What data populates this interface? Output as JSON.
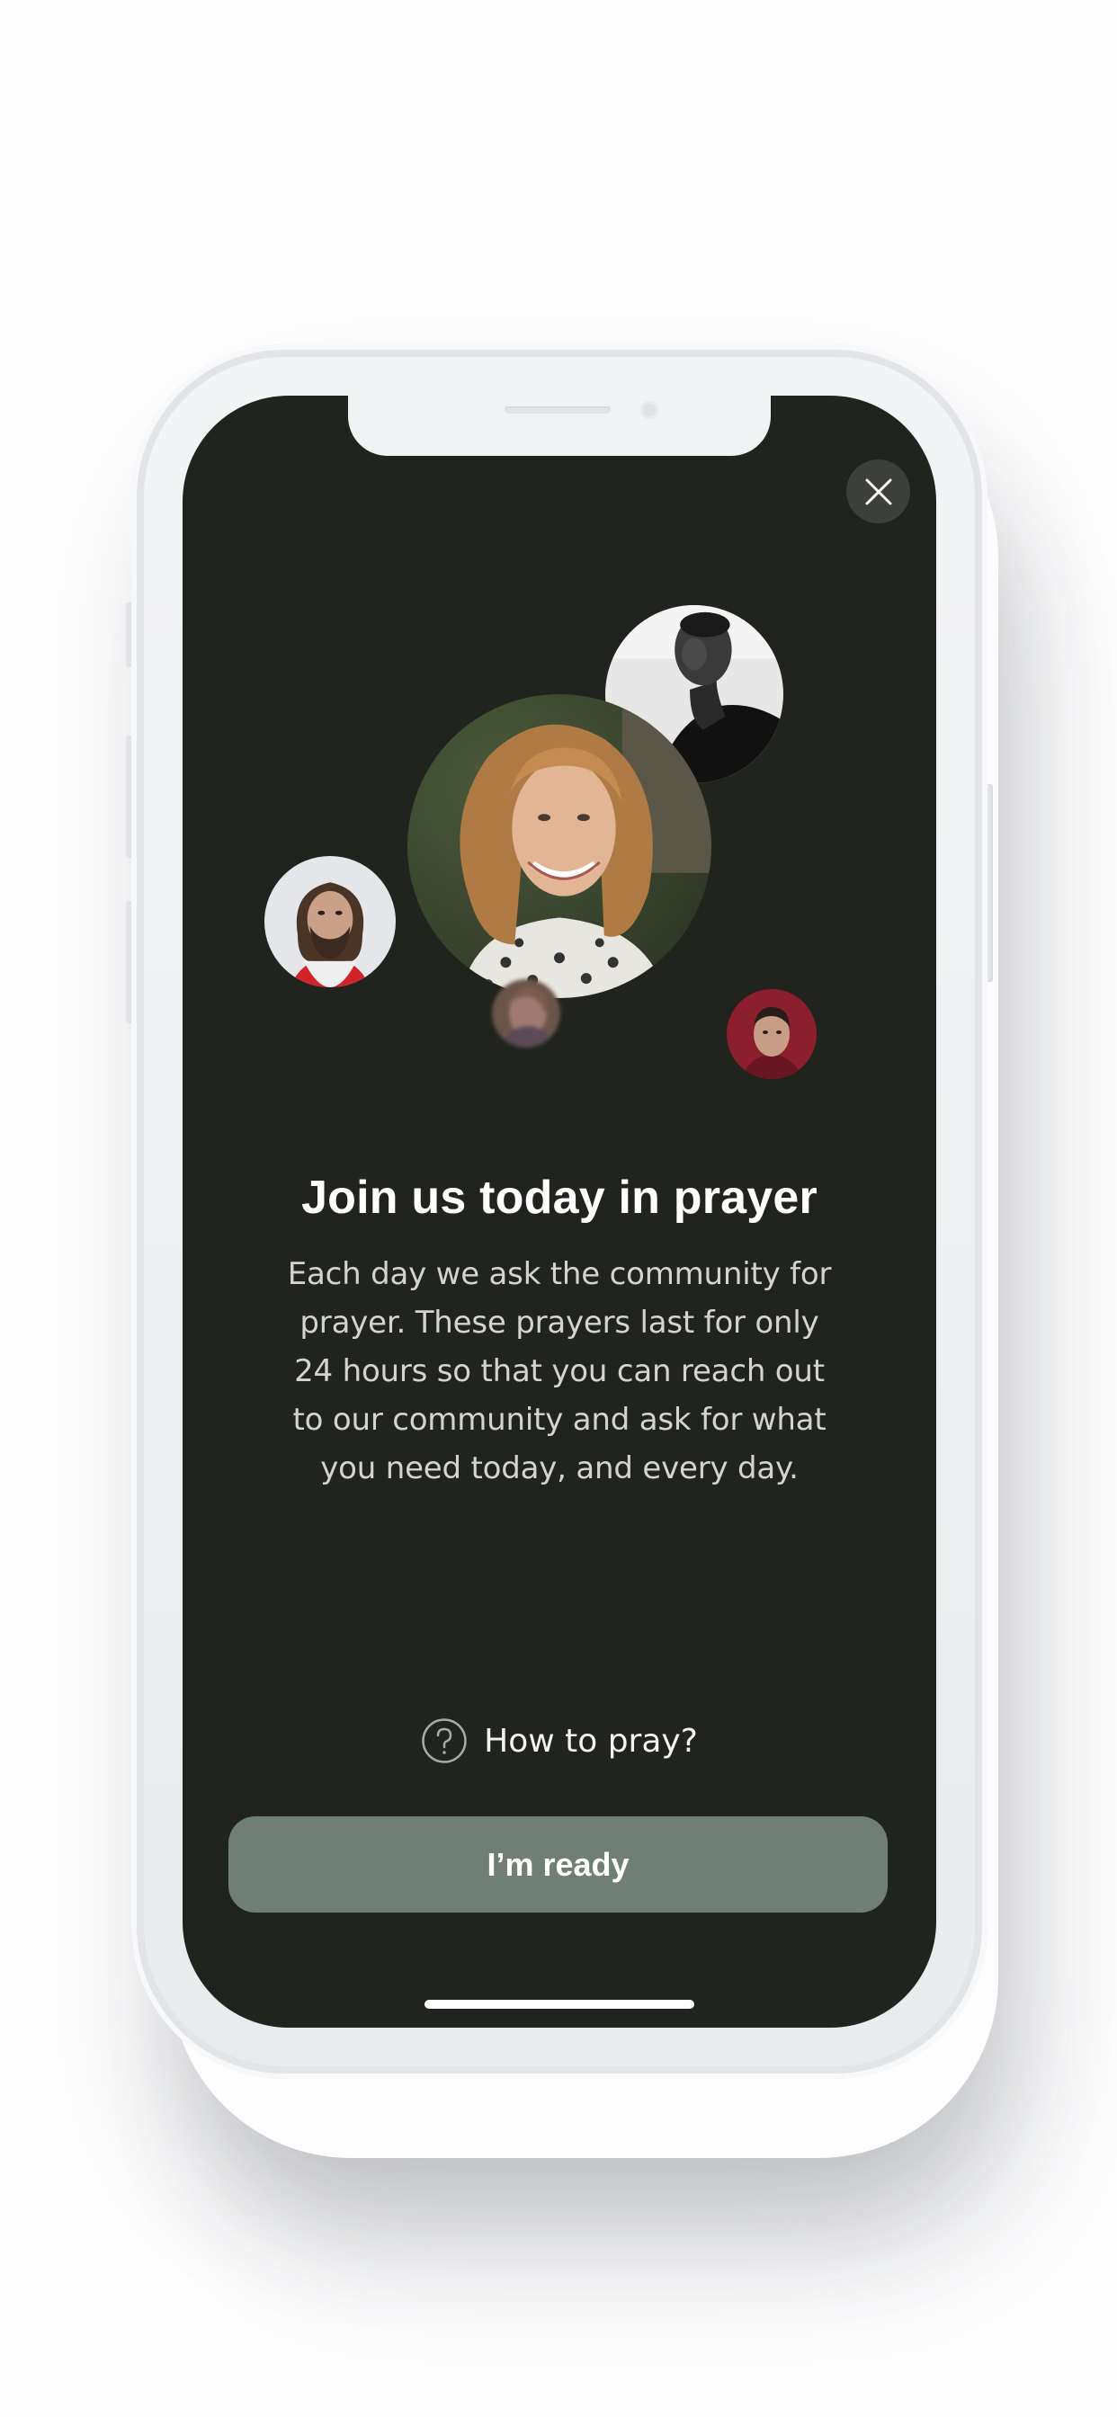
{
  "modal": {
    "title": "Join us today in prayer",
    "description": "Each day we ask the community for prayer. These prayers last for only 24 hours so that you can reach out to our community and ask for what you need today, and every day.",
    "help_link": "How to pray?",
    "primary_button": "I’m ready"
  },
  "icons": {
    "close": "close-icon",
    "help": "question-circle-icon"
  },
  "colors": {
    "background": "#21241e",
    "button": "#707f75",
    "close_button": "#3c3f3a"
  }
}
